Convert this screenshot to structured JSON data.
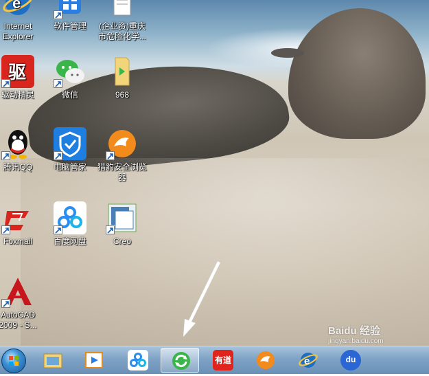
{
  "desktop": {
    "icons": [
      {
        "label": "Internet Explorer",
        "icon": "internet-explorer-icon"
      },
      {
        "label": "软件管理",
        "icon": "software-manager-icon"
      },
      {
        "label": "(企业资)重庆市危险化学...",
        "icon": "document-icon"
      },
      {
        "label": "驱动精灵",
        "icon": "driver-genius-icon"
      },
      {
        "label": "微信",
        "icon": "wechat-icon"
      },
      {
        "label": "968",
        "icon": "folder-icon"
      },
      {
        "label": "腾讯QQ",
        "icon": "qq-icon"
      },
      {
        "label": "电脑管家",
        "icon": "pc-manager-icon"
      },
      {
        "label": "猎豹安全浏览器",
        "icon": "liebao-browser-icon"
      },
      {
        "label": "Foxmail",
        "icon": "foxmail-icon"
      },
      {
        "label": "百度网盘",
        "icon": "baidu-netdisk-icon"
      },
      {
        "label": "Creo",
        "icon": "creo-icon"
      },
      {
        "label": "AutoCAD 2009 - S...",
        "icon": "autocad-icon"
      }
    ]
  },
  "taskbar": {
    "start_icon": "windows-start-icon",
    "items": [
      {
        "icon": "file-explorer-icon",
        "active": false
      },
      {
        "icon": "media-player-icon",
        "active": false
      },
      {
        "icon": "baidu-netdisk-icon",
        "active": false
      },
      {
        "icon": "refresh-app-icon",
        "active": true
      },
      {
        "icon": "youdao-icon",
        "label": "有道",
        "active": false
      },
      {
        "icon": "liebao-browser-icon",
        "active": false
      },
      {
        "icon": "internet-explorer-icon",
        "active": false
      },
      {
        "icon": "baidu-icon",
        "label": "du",
        "active": false
      }
    ]
  },
  "watermark": {
    "text": "Baidu 经验",
    "sub": "jingyan.baidu.com"
  },
  "colors": {
    "taskbar": "#7fa3c6",
    "arrow": "#ffffff",
    "ie_blue": "#1e6fc4",
    "qq_black": "#111111"
  }
}
